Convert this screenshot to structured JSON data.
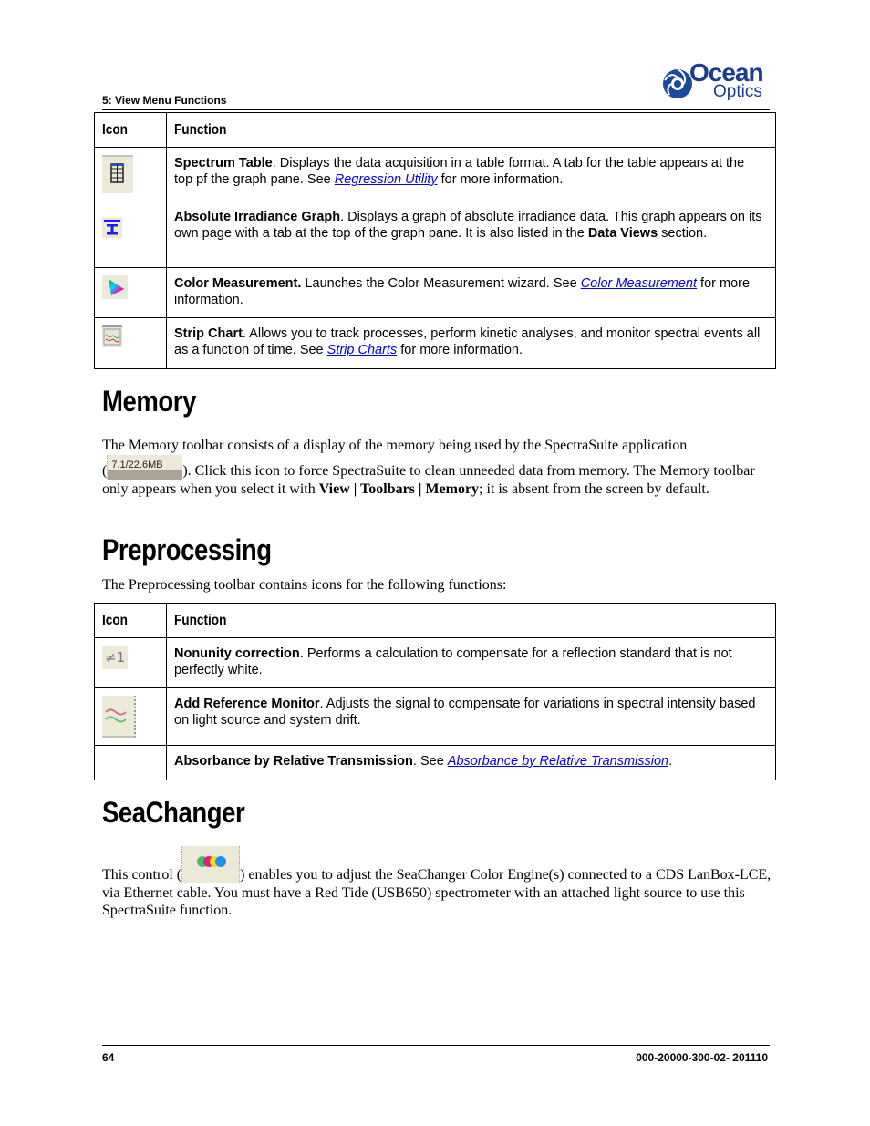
{
  "header": {
    "section_label": "5: View Menu Functions",
    "logo": {
      "word1": "Ocean",
      "word2": "Optics",
      "icon": "ocean-optics-logo-icon",
      "color": "#1a3e8c"
    }
  },
  "table1": {
    "headers": {
      "icon": "Icon",
      "function": "Function"
    },
    "rows": [
      {
        "icon": "spectrum-table-icon",
        "title": "Spectrum Table",
        "text_before": ". Displays the data acquisition in a table format. A tab for the table appears at the top pf the graph pane. See ",
        "link": "Regression Utility",
        "text_after": " for more information."
      },
      {
        "icon": "absolute-irradiance-icon",
        "title": "Absolute Irradiance Graph",
        "text_before": ". Displays a graph of absolute irradiance data. This graph appears on its own page with a tab at the top of the graph pane. It is also listed in the ",
        "bold2": "Data Views",
        "text_after": " section."
      },
      {
        "icon": "color-measurement-icon",
        "title": "Color Measurement.",
        "text_before": " Launches the Color Measurement wizard. See ",
        "link": "Color Measurement",
        "text_after": " for more information."
      },
      {
        "icon": "strip-chart-icon",
        "title": "Strip Chart",
        "text_before": ". Allows you to track processes, perform kinetic analyses, and monitor spectral events all as a function of time. See ",
        "link": "Strip Charts",
        "text_after": " for more information."
      }
    ]
  },
  "memory": {
    "heading": "Memory",
    "p1": "The Memory toolbar consists of a display of the memory being used by the SpectraSuite application",
    "open_paren": "(",
    "icon_text": "7.1/22.6MB",
    "p2": "). Click this icon to force SpectraSuite to clean unneeded data from memory. The Memory toolbar only appears when you select it with ",
    "menu_path": "View | Toolbars | Memory",
    "p3": "; it is absent from the screen by default."
  },
  "preprocessing": {
    "heading": "Preprocessing",
    "intro": "The Preprocessing toolbar contains icons for the following functions:",
    "headers": {
      "icon": "Icon",
      "function": "Function"
    },
    "rows": [
      {
        "icon": "nonunity-correction-icon",
        "icon_glyph": "≠1",
        "title": "Nonunity correction",
        "text": ". Performs a calculation to compensate for a reflection standard that is not perfectly white."
      },
      {
        "icon": "reference-monitor-icon",
        "icon_glyph": "≈",
        "title": "Add Reference Monitor",
        "text": ". Adjusts the signal to compensate for variations in spectral intensity based on light source and system drift."
      },
      {
        "icon": "",
        "title": "Absorbance by Relative Transmission",
        "text": ". See ",
        "link": "Absorbance by Relative Transmission",
        "text_after": "."
      }
    ]
  },
  "seachanger": {
    "heading": "SeaChanger",
    "p1": "This control (",
    "icon": "seachanger-color-engine-icon",
    "p2": ") enables you to adjust the SeaChanger Color Engine(s) connected to a CDS LanBox-LCE, via Ethernet cable. You must have a Red Tide (USB650) spectrometer with an attached light source to use this SpectraSuite function."
  },
  "footer": {
    "page_number": "64",
    "doc_number": "000-20000-300-02- 201110"
  }
}
